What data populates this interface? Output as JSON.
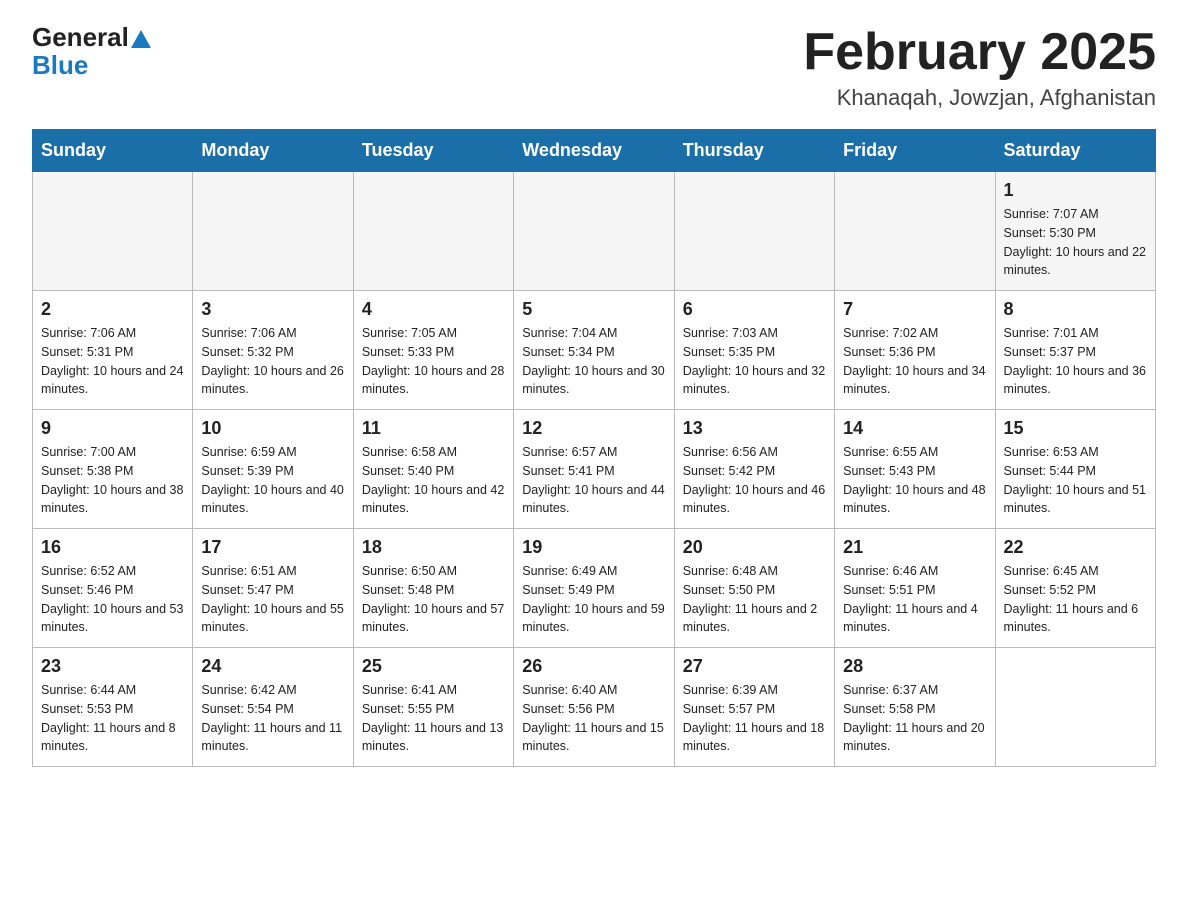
{
  "header": {
    "logo_general": "General",
    "logo_blue": "Blue",
    "month_title": "February 2025",
    "location": "Khanaqah, Jowzjan, Afghanistan"
  },
  "weekdays": [
    "Sunday",
    "Monday",
    "Tuesday",
    "Wednesday",
    "Thursday",
    "Friday",
    "Saturday"
  ],
  "weeks": [
    [
      {
        "day": "",
        "info": ""
      },
      {
        "day": "",
        "info": ""
      },
      {
        "day": "",
        "info": ""
      },
      {
        "day": "",
        "info": ""
      },
      {
        "day": "",
        "info": ""
      },
      {
        "day": "",
        "info": ""
      },
      {
        "day": "1",
        "info": "Sunrise: 7:07 AM\nSunset: 5:30 PM\nDaylight: 10 hours and 22 minutes."
      }
    ],
    [
      {
        "day": "2",
        "info": "Sunrise: 7:06 AM\nSunset: 5:31 PM\nDaylight: 10 hours and 24 minutes."
      },
      {
        "day": "3",
        "info": "Sunrise: 7:06 AM\nSunset: 5:32 PM\nDaylight: 10 hours and 26 minutes."
      },
      {
        "day": "4",
        "info": "Sunrise: 7:05 AM\nSunset: 5:33 PM\nDaylight: 10 hours and 28 minutes."
      },
      {
        "day": "5",
        "info": "Sunrise: 7:04 AM\nSunset: 5:34 PM\nDaylight: 10 hours and 30 minutes."
      },
      {
        "day": "6",
        "info": "Sunrise: 7:03 AM\nSunset: 5:35 PM\nDaylight: 10 hours and 32 minutes."
      },
      {
        "day": "7",
        "info": "Sunrise: 7:02 AM\nSunset: 5:36 PM\nDaylight: 10 hours and 34 minutes."
      },
      {
        "day": "8",
        "info": "Sunrise: 7:01 AM\nSunset: 5:37 PM\nDaylight: 10 hours and 36 minutes."
      }
    ],
    [
      {
        "day": "9",
        "info": "Sunrise: 7:00 AM\nSunset: 5:38 PM\nDaylight: 10 hours and 38 minutes."
      },
      {
        "day": "10",
        "info": "Sunrise: 6:59 AM\nSunset: 5:39 PM\nDaylight: 10 hours and 40 minutes."
      },
      {
        "day": "11",
        "info": "Sunrise: 6:58 AM\nSunset: 5:40 PM\nDaylight: 10 hours and 42 minutes."
      },
      {
        "day": "12",
        "info": "Sunrise: 6:57 AM\nSunset: 5:41 PM\nDaylight: 10 hours and 44 minutes."
      },
      {
        "day": "13",
        "info": "Sunrise: 6:56 AM\nSunset: 5:42 PM\nDaylight: 10 hours and 46 minutes."
      },
      {
        "day": "14",
        "info": "Sunrise: 6:55 AM\nSunset: 5:43 PM\nDaylight: 10 hours and 48 minutes."
      },
      {
        "day": "15",
        "info": "Sunrise: 6:53 AM\nSunset: 5:44 PM\nDaylight: 10 hours and 51 minutes."
      }
    ],
    [
      {
        "day": "16",
        "info": "Sunrise: 6:52 AM\nSunset: 5:46 PM\nDaylight: 10 hours and 53 minutes."
      },
      {
        "day": "17",
        "info": "Sunrise: 6:51 AM\nSunset: 5:47 PM\nDaylight: 10 hours and 55 minutes."
      },
      {
        "day": "18",
        "info": "Sunrise: 6:50 AM\nSunset: 5:48 PM\nDaylight: 10 hours and 57 minutes."
      },
      {
        "day": "19",
        "info": "Sunrise: 6:49 AM\nSunset: 5:49 PM\nDaylight: 10 hours and 59 minutes."
      },
      {
        "day": "20",
        "info": "Sunrise: 6:48 AM\nSunset: 5:50 PM\nDaylight: 11 hours and 2 minutes."
      },
      {
        "day": "21",
        "info": "Sunrise: 6:46 AM\nSunset: 5:51 PM\nDaylight: 11 hours and 4 minutes."
      },
      {
        "day": "22",
        "info": "Sunrise: 6:45 AM\nSunset: 5:52 PM\nDaylight: 11 hours and 6 minutes."
      }
    ],
    [
      {
        "day": "23",
        "info": "Sunrise: 6:44 AM\nSunset: 5:53 PM\nDaylight: 11 hours and 8 minutes."
      },
      {
        "day": "24",
        "info": "Sunrise: 6:42 AM\nSunset: 5:54 PM\nDaylight: 11 hours and 11 minutes."
      },
      {
        "day": "25",
        "info": "Sunrise: 6:41 AM\nSunset: 5:55 PM\nDaylight: 11 hours and 13 minutes."
      },
      {
        "day": "26",
        "info": "Sunrise: 6:40 AM\nSunset: 5:56 PM\nDaylight: 11 hours and 15 minutes."
      },
      {
        "day": "27",
        "info": "Sunrise: 6:39 AM\nSunset: 5:57 PM\nDaylight: 11 hours and 18 minutes."
      },
      {
        "day": "28",
        "info": "Sunrise: 6:37 AM\nSunset: 5:58 PM\nDaylight: 11 hours and 20 minutes."
      },
      {
        "day": "",
        "info": ""
      }
    ]
  ]
}
